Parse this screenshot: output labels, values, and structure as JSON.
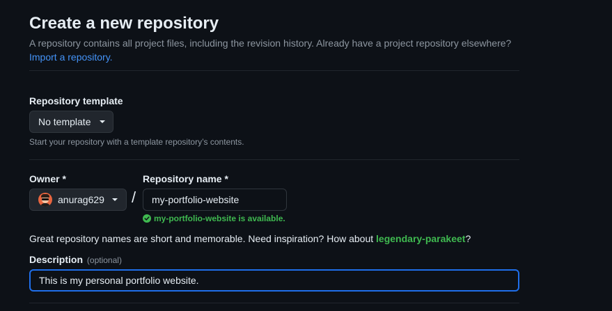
{
  "header": {
    "title": "Create a new repository",
    "subtitle": "A repository contains all project files, including the revision history. Already have a project repository elsewhere?",
    "import_link": "Import a repository."
  },
  "template": {
    "label": "Repository template",
    "selected": "No template",
    "help": "Start your repository with a template repository’s contents."
  },
  "owner": {
    "label": "Owner *",
    "selected": "anurag629"
  },
  "slash": "/",
  "repo_name": {
    "label": "Repository name *",
    "value": "my-portfolio-website",
    "availability": "my-portfolio-website is available."
  },
  "inspiration": {
    "prefix": "Great repository names are short and memorable. Need inspiration? How about ",
    "suggestion": "legendary-parakeet",
    "suffix": "?"
  },
  "description": {
    "label": "Description",
    "optional": "(optional)",
    "value": "This is my personal portfolio website."
  },
  "colors": {
    "background": "#0d1117",
    "link": "#4493f8",
    "success": "#3fb950",
    "focus": "#1f6feb"
  }
}
